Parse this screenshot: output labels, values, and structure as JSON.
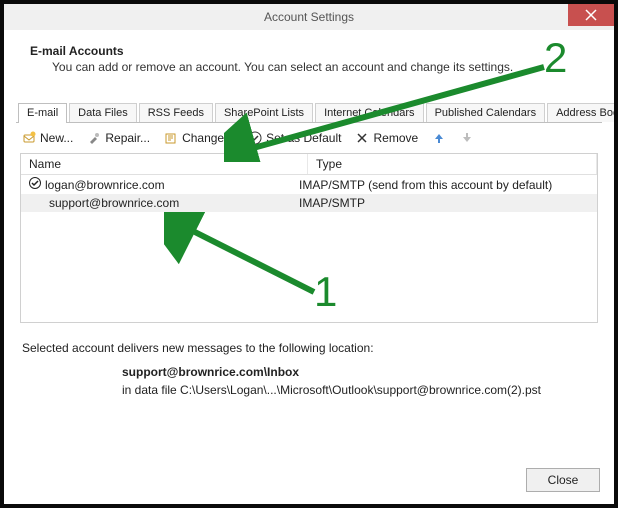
{
  "titlebar": {
    "title": "Account Settings",
    "close_icon": "close-icon"
  },
  "header": {
    "title": "E-mail Accounts",
    "subtitle": "You can add or remove an account. You can select an account and change its settings."
  },
  "tabs": [
    {
      "label": "E-mail",
      "active": true
    },
    {
      "label": "Data Files"
    },
    {
      "label": "RSS Feeds"
    },
    {
      "label": "SharePoint Lists"
    },
    {
      "label": "Internet Calendars"
    },
    {
      "label": "Published Calendars"
    },
    {
      "label": "Address Books"
    }
  ],
  "toolbar": {
    "new_label": "New...",
    "repair_label": "Repair...",
    "change_label": "Change...",
    "default_label": "Set as Default",
    "remove_label": "Remove"
  },
  "list": {
    "columns": {
      "name": "Name",
      "type": "Type"
    },
    "rows": [
      {
        "name": "logan@brownrice.com",
        "type": "IMAP/SMTP (send from this account by default)",
        "is_default": true,
        "selected": false
      },
      {
        "name": "support@brownrice.com",
        "type": "IMAP/SMTP",
        "is_default": false,
        "selected": true
      }
    ]
  },
  "info": {
    "intro": "Selected account delivers new messages to the following location:",
    "location_title": "support@brownrice.com\\Inbox",
    "location_detail": "in data file C:\\Users\\Logan\\...\\Microsoft\\Outlook\\support@brownrice.com(2).pst"
  },
  "footer": {
    "close_label": "Close"
  },
  "annotations": {
    "num1": "1",
    "num2": "2"
  },
  "colors": {
    "annotation_green": "#1b8a2d",
    "titlebar_close": "#c8504f"
  }
}
